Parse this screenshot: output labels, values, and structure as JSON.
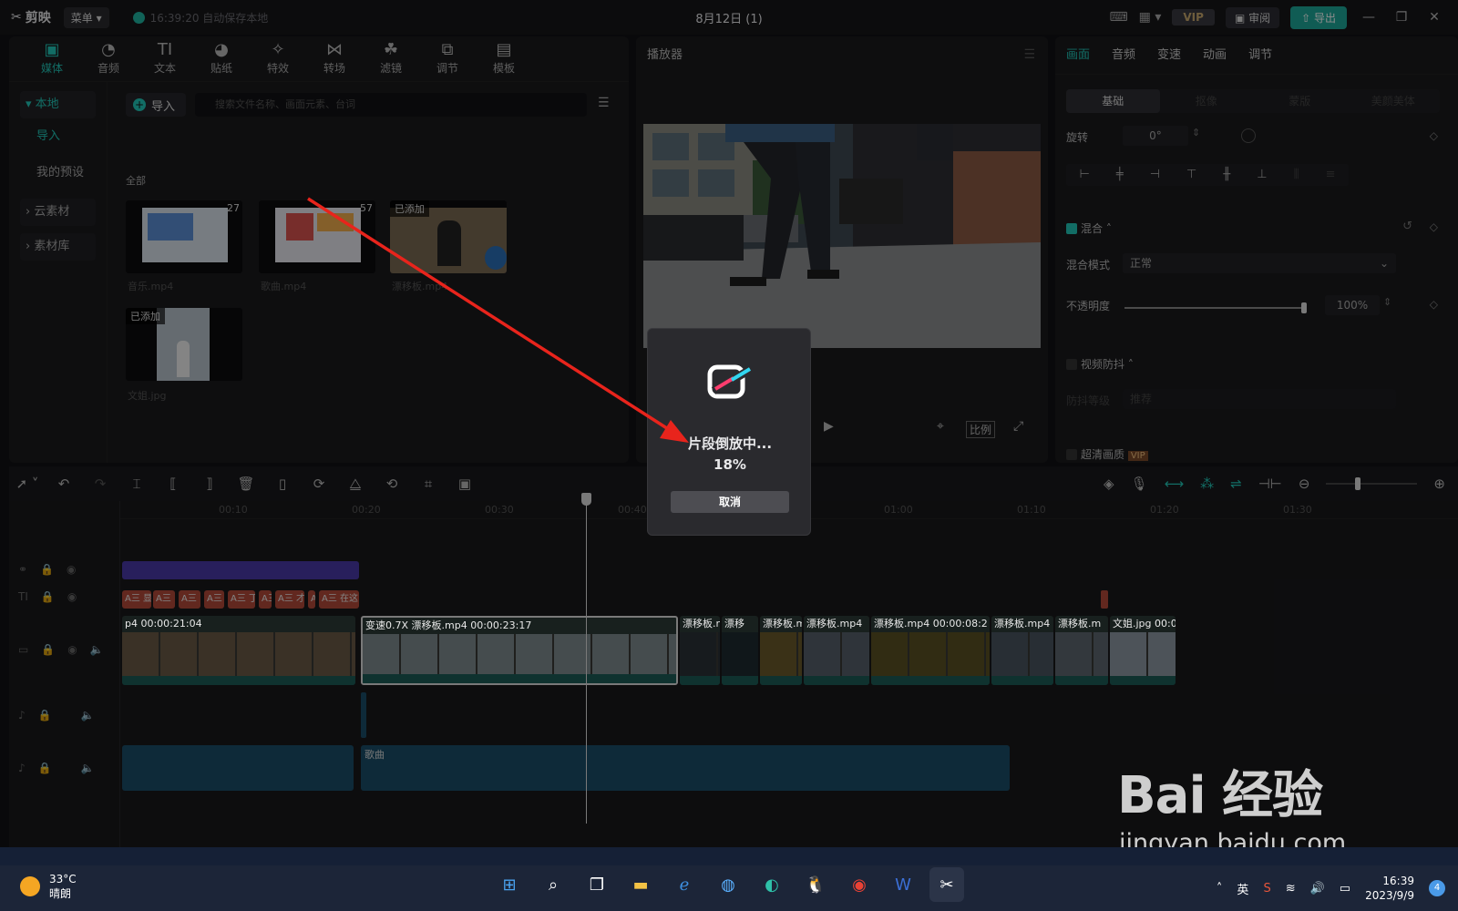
{
  "app": {
    "name": "剪映",
    "menu_label": "菜单",
    "autosave": "16:39:20 自动保存本地",
    "doc_title": "8月12日 (1)"
  },
  "titlebar": {
    "vip": "VIP",
    "review": "审阅",
    "export": "导出"
  },
  "media_tabs": [
    {
      "label": "媒体",
      "icon": "media-icon"
    },
    {
      "label": "音频",
      "icon": "audio-icon"
    },
    {
      "label": "文本",
      "icon": "text-icon"
    },
    {
      "label": "贴纸",
      "icon": "sticker-icon"
    },
    {
      "label": "特效",
      "icon": "effects-icon"
    },
    {
      "label": "转场",
      "icon": "transition-icon"
    },
    {
      "label": "滤镜",
      "icon": "filter-icon"
    },
    {
      "label": "调节",
      "icon": "adjust-icon"
    },
    {
      "label": "模板",
      "icon": "template-icon"
    }
  ],
  "side_nav": {
    "local": "本地",
    "import": "导入",
    "presets": "我的预设",
    "cloud": "云素材",
    "library": "素材库"
  },
  "media": {
    "import_label": "导入",
    "search_placeholder": "搜索文件名称、画面元素、台词",
    "all_label": "全部",
    "items": [
      {
        "name": "音乐.mp4",
        "duration": "27",
        "tag": ""
      },
      {
        "name": "歌曲.mp4",
        "duration": "57",
        "tag": ""
      },
      {
        "name": "漂移板.mp4",
        "duration": "",
        "tag": "已添加"
      },
      {
        "name": "文姐.jpg",
        "duration": "",
        "tag": "已添加"
      }
    ]
  },
  "player": {
    "title": "播放器",
    "ratio_label": "比例"
  },
  "props": {
    "tabs": [
      "画面",
      "音频",
      "变速",
      "动画",
      "调节"
    ],
    "subtabs": [
      "基础",
      "抠像",
      "蒙版",
      "美颜美体"
    ],
    "rotate_label": "旋转",
    "rotate_value": "0°",
    "blend_label": "混合",
    "blend_mode_label": "混合模式",
    "blend_mode_value": "正常",
    "opacity_label": "不透明度",
    "opacity_value": "100%",
    "opacity": 1.0,
    "stabilize_label": "视频防抖",
    "stabilize_level_label": "防抖等级",
    "stabilize_level_value": "推荐",
    "hd_label": "超清画质"
  },
  "ruler": [
    "00:10",
    "00:20",
    "00:30",
    "00:40",
    "01:00",
    "01:10",
    "01:20",
    "01:30"
  ],
  "text_clips": [
    "A三 显",
    "A三",
    "A三",
    "A三",
    "A三 丁",
    "A三",
    "A三 才",
    "A",
    "A三 在这"
  ],
  "video_clips": [
    {
      "label": "p4  00:00:21:04"
    },
    {
      "label": "变速0.7X  漂移板.mp4  00:00:23:17"
    },
    {
      "label": "漂移板.r"
    },
    {
      "label": "漂移"
    },
    {
      "label": "漂移板.m"
    },
    {
      "label": "漂移板.mp4"
    },
    {
      "label": "漂移板.mp4  00:00:08:2"
    },
    {
      "label": "漂移板.mp4"
    },
    {
      "label": "漂移板.m"
    },
    {
      "label": "文姐.jpg  00:0"
    }
  ],
  "audio_clip_label": "歌曲",
  "dialog": {
    "title": "片段倒放中...",
    "percent_text": "18%",
    "progress": 0.18,
    "cancel": "取消"
  },
  "watermark": {
    "brand": "Bai 经验",
    "url": "jingyan.baidu.com"
  },
  "taskbar": {
    "temp": "33°C",
    "weather": "晴朗",
    "ime": "英",
    "time": "16:39",
    "date": "2023/9/9",
    "notifications": "4"
  },
  "colors": {
    "accent": "#22c7b8",
    "arrow": "#e8241c",
    "dialog_bg": "#2a2a2e"
  }
}
